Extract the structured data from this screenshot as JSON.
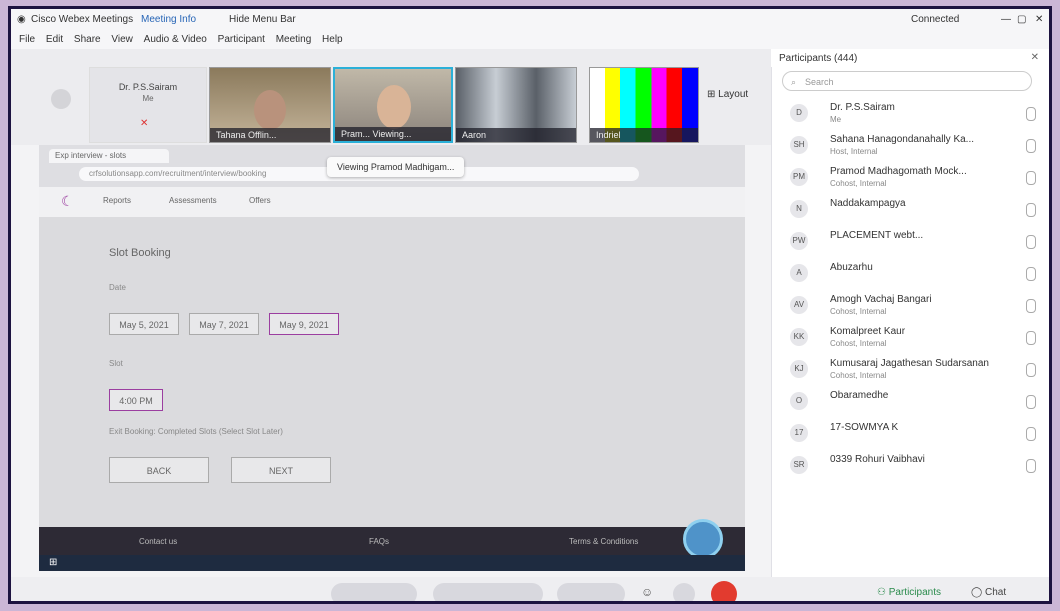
{
  "app": {
    "title": "Cisco Webex Meetings",
    "meeting_info": "Meeting Info",
    "hide_menu": "Hide Menu Bar",
    "connected": "Connected"
  },
  "menu": [
    "File",
    "Edit",
    "Share",
    "View",
    "Audio & Video",
    "Participant",
    "Meeting",
    "Help"
  ],
  "videos": [
    {
      "name": "Dr. P.S.Sairam",
      "sub": "Me"
    },
    {
      "name": "Tahana",
      "sub": "Offlin..."
    },
    {
      "name": "Pram...",
      "sub": "Viewing..."
    },
    {
      "name": "Aaron",
      "sub": ""
    },
    {
      "name": "Indriel",
      "sub": ""
    }
  ],
  "layout_label": "Layout",
  "viewing_banner": "Viewing Pramod Madhigam...",
  "browser": {
    "tab": "Exp interview - slots",
    "url": "crfsolutionsapp.com/recruitment/interview/booking",
    "nav": [
      "Reports",
      "Assessments",
      "Offers"
    ]
  },
  "booking": {
    "title": "Slot Booking",
    "date_label": "Date",
    "dates": [
      "May 5, 2021",
      "May 7, 2021",
      "May 9, 2021"
    ],
    "slot_label": "Slot",
    "slot_value": "4:00 PM",
    "note": "Exit Booking: Completed Slots (Select Slot Later)",
    "btn_back": "BACK",
    "btn_next": "NEXT"
  },
  "footer_links": [
    "Contact us",
    "FAQs",
    "Terms & Conditions"
  ],
  "participants": {
    "title": "Participants (444)",
    "search_placeholder": "Search",
    "list": [
      {
        "initials": "D",
        "name": "Dr. P.S.Sairam",
        "sub": "Me"
      },
      {
        "initials": "SH",
        "name": "Sahana Hanagondanahally Ka...",
        "sub": "Host, Internal"
      },
      {
        "initials": "PM",
        "name": "Pramod Madhagomath Mock...",
        "sub": "Cohost, Internal"
      },
      {
        "initials": "N",
        "name": "Naddakampagya",
        "sub": ""
      },
      {
        "initials": "PW",
        "name": "PLACEMENT webt...",
        "sub": ""
      },
      {
        "initials": "A",
        "name": "Abuzarhu",
        "sub": ""
      },
      {
        "initials": "AV",
        "name": "Amogh Vachaj Bangari",
        "sub": "Cohost, Internal"
      },
      {
        "initials": "KK",
        "name": "Komalpreet Kaur",
        "sub": "Cohost, Internal"
      },
      {
        "initials": "KJ",
        "name": "Kumusaraj Jagathesan Sudarsanan",
        "sub": "Cohost, Internal"
      },
      {
        "initials": "O",
        "name": "Obaramedhe",
        "sub": ""
      },
      {
        "initials": "17",
        "name": "17-SOWMYA K",
        "sub": ""
      },
      {
        "initials": "SR",
        "name": "0339 Rohuri Vaibhavi",
        "sub": ""
      }
    ]
  },
  "bottom": {
    "participants": "Participants",
    "chat": "Chat"
  }
}
